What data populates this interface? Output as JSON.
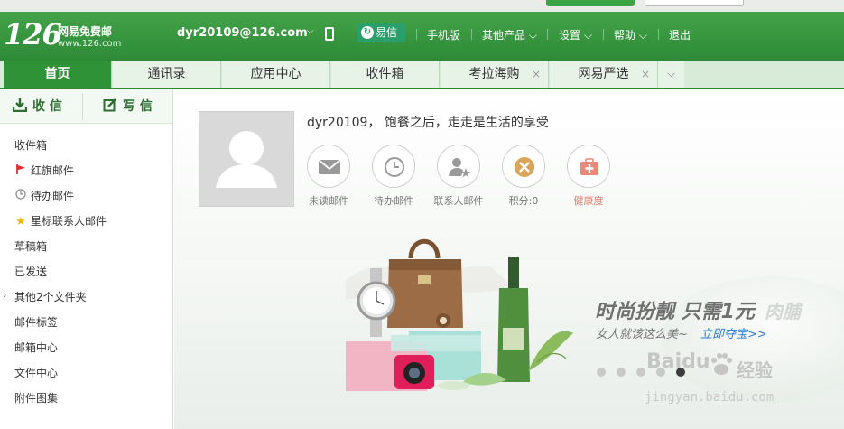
{
  "header": {
    "logo_number": "126",
    "logo_name": "网易免费邮",
    "logo_url": "www.126.com",
    "user_email": "dyr20109@126.com",
    "yixin_label": "易信",
    "links": [
      "手机版",
      "其他产品",
      "设置",
      "帮助",
      "退出"
    ]
  },
  "tabs": [
    {
      "label": "首页",
      "active": true,
      "closable": false
    },
    {
      "label": "通讯录",
      "active": false,
      "closable": false
    },
    {
      "label": "应用中心",
      "active": false,
      "closable": false
    },
    {
      "label": "收件箱",
      "active": false,
      "closable": false
    },
    {
      "label": "考拉海购",
      "active": false,
      "closable": true
    },
    {
      "label": "网易严选",
      "active": false,
      "closable": true
    }
  ],
  "tab_close_glyph": "×",
  "sidebar": {
    "receive_label": "收 信",
    "write_label": "写 信",
    "folders": [
      {
        "label": "收件箱",
        "icon": ""
      },
      {
        "label": "红旗邮件",
        "icon": "red-flag-icon"
      },
      {
        "label": "待办邮件",
        "icon": "clock-icon"
      },
      {
        "label": "星标联系人邮件",
        "icon": "star-icon"
      },
      {
        "label": "草稿箱",
        "icon": ""
      },
      {
        "label": "已发送",
        "icon": ""
      },
      {
        "label": "其他2个文件夹",
        "icon": "chevron-right-icon"
      },
      {
        "label": "邮件标签",
        "icon": ""
      },
      {
        "label": "邮箱中心",
        "icon": ""
      },
      {
        "label": "文件中心",
        "icon": ""
      },
      {
        "label": "附件图集",
        "icon": ""
      }
    ]
  },
  "main": {
    "greeting": "dyr20109， 饱餐之后，走走是生活的享受",
    "stats": [
      {
        "label": "未读邮件",
        "icon": "mail-icon"
      },
      {
        "label": "待办邮件",
        "icon": "clock-icon"
      },
      {
        "label": "联系人邮件",
        "icon": "contact-star-icon"
      },
      {
        "label": "积分:0",
        "icon": "points-icon"
      },
      {
        "label": "健康度",
        "icon": "health-icon"
      }
    ]
  },
  "banner": {
    "title": "时尚扮靓 只需1元",
    "title_fade": "肉脯",
    "subtitle": "女人就该这么美~",
    "link": "立即夺宝>>",
    "active_dot": 4
  },
  "watermark": {
    "brand": "Baidu",
    "suffix": "经验",
    "url": "jingyan.baidu.com"
  },
  "colors": {
    "brand_green": "#2e8a36",
    "active_tab": "#2f9236",
    "link_blue": "#2a7bd0"
  }
}
